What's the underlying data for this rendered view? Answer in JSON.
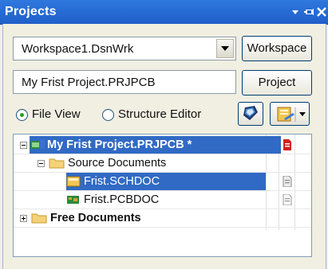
{
  "panel": {
    "title": "Projects"
  },
  "workspace": {
    "value": "Workspace1.DsnWrk",
    "button_label": "Workspace"
  },
  "project": {
    "value": "My Frist Project.PRJPCB",
    "button_label": "Project"
  },
  "view": {
    "options": [
      "File View",
      "Structure Editor"
    ],
    "selected": "File View"
  },
  "tree": {
    "project": {
      "label": "My Frist Project.PRJPCB *"
    },
    "source_folder": {
      "label": "Source Documents"
    },
    "files": [
      {
        "label": "Frist.SCHDOC"
      },
      {
        "label": "Frist.PCBDOC"
      }
    ],
    "free_folder": {
      "label": "Free Documents"
    }
  },
  "colors": {
    "title_bar": "#2868d8",
    "selection": "#316ac5",
    "frame": "#f1efe2",
    "modified_doc_icon": "#d02020"
  },
  "icons": [
    "chevron-down-icon",
    "pin-icon",
    "close-icon",
    "compile-icon",
    "document-menu-icon",
    "project-icon",
    "folder-icon",
    "schematic-icon",
    "pcb-icon",
    "document-icon"
  ]
}
